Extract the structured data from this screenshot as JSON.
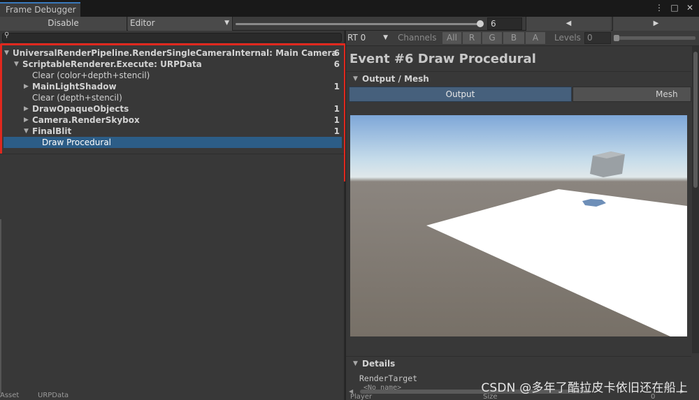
{
  "window": {
    "tab_title": "Frame Debugger",
    "menu_icons": [
      "more-icon",
      "maximize-icon",
      "close-icon"
    ],
    "menu_glyphs": [
      "⋮",
      "□",
      "✕"
    ]
  },
  "toolbar": {
    "disable_label": "Disable",
    "target_label": "Editor",
    "step_value": "6",
    "step_fraction": 1.0,
    "prev_glyph": "◀",
    "next_glyph": "▶"
  },
  "tree": {
    "search_placeholder": "",
    "items": [
      {
        "label": "UniversalRenderPipeline.RenderSingleCameraInternal: Main Camera",
        "count": "6",
        "depth": 0,
        "expanded": true,
        "bold": true
      },
      {
        "label": "ScriptableRenderer.Execute: URPData",
        "count": "6",
        "depth": 1,
        "expanded": true,
        "bold": true
      },
      {
        "label": "Clear (color+depth+stencil)",
        "count": "",
        "depth": 2,
        "leaf": true,
        "bold": false
      },
      {
        "label": "MainLightShadow",
        "count": "1",
        "depth": 2,
        "expanded": false,
        "bold": true
      },
      {
        "label": "Clear (depth+stencil)",
        "count": "",
        "depth": 2,
        "leaf": true,
        "bold": false
      },
      {
        "label": "DrawOpaqueObjects",
        "count": "1",
        "depth": 2,
        "expanded": false,
        "bold": true
      },
      {
        "label": "Camera.RenderSkybox",
        "count": "1",
        "depth": 2,
        "expanded": false,
        "bold": true
      },
      {
        "label": "FinalBlit",
        "count": "1",
        "depth": 2,
        "expanded": true,
        "bold": true
      },
      {
        "label": "Draw Procedural",
        "count": "",
        "depth": 3,
        "leaf": true,
        "bold": false,
        "selected": true
      }
    ],
    "footer_left": "Asset",
    "footer_mid": "URPData",
    "highlight_color": "#e0281e",
    "selected_color": "#2c5d87"
  },
  "right": {
    "rt_label": "RT 0",
    "channels_label": "Channels",
    "channels": [
      "All",
      "R",
      "G",
      "B",
      "A"
    ],
    "levels_label": "Levels",
    "levels_value": "0",
    "event_title": "Event #6 Draw Procedural",
    "output_section": "Output / Mesh",
    "tab_output": "Output",
    "tab_mesh": "Mesh Preview",
    "details_section": "Details",
    "details_render_target": "RenderTarget",
    "details_no_name": "<No name>",
    "footer_left": "Player",
    "footer_mid": "Size",
    "footer_right": "0"
  },
  "watermark": "CSDN @多年了酷拉皮卡依旧还在船上"
}
